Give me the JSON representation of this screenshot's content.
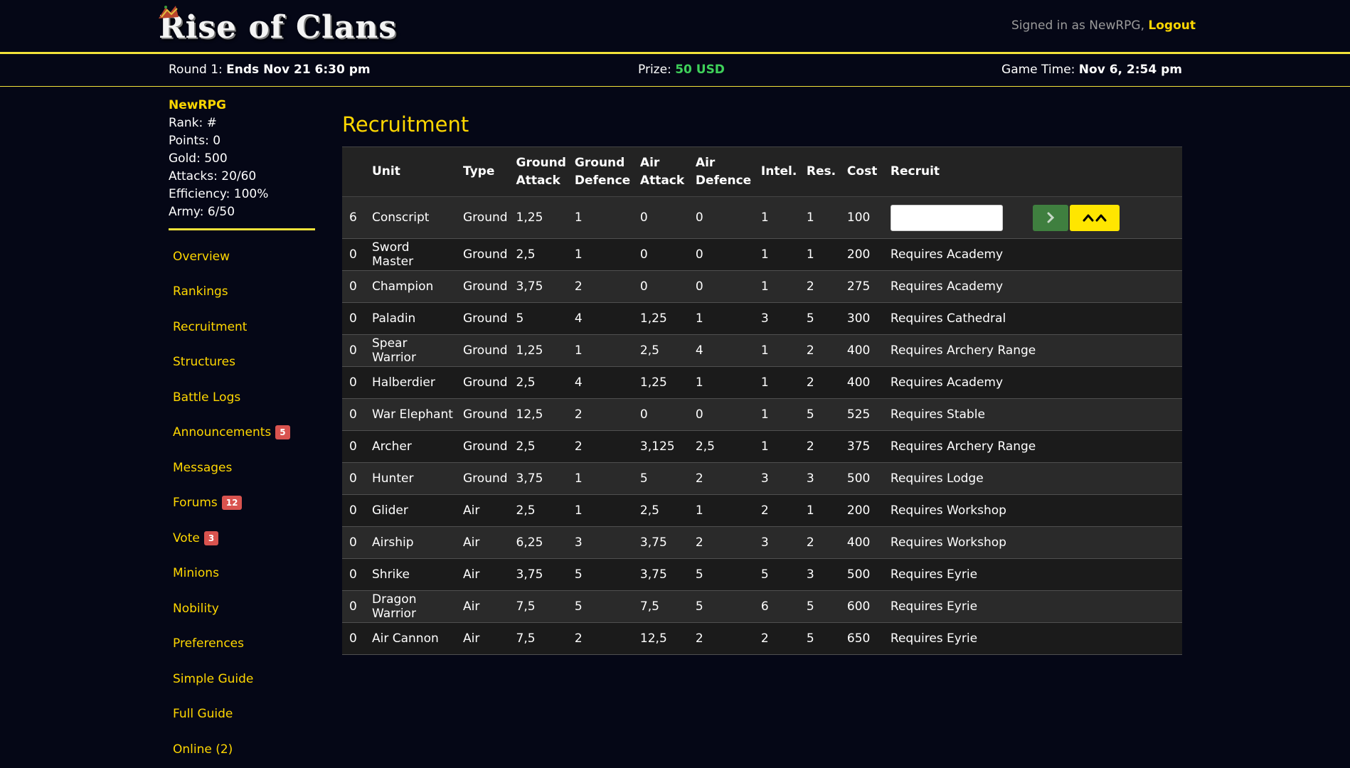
{
  "header": {
    "logo_text": "Rise of Clans",
    "signed_in_prefix": "Signed in as NewRPG,",
    "logout_label": "Logout"
  },
  "infobar": {
    "round_label": "Round 1:",
    "round_value": "Ends Nov 21 6:30 pm",
    "prize_label": "Prize:",
    "prize_value": "50 USD",
    "time_label": "Game Time:",
    "time_value": "Nov 6, 2:54 pm"
  },
  "sidebar": {
    "username": "NewRPG",
    "stats": [
      "Rank: #",
      "Points: 0",
      "Gold: 500",
      "Attacks: 20/60",
      "Efficiency: 100%",
      "Army: 6/50"
    ],
    "nav": [
      {
        "label": "Overview",
        "badge": null
      },
      {
        "label": "Rankings",
        "badge": null
      },
      {
        "label": "Recruitment",
        "badge": null
      },
      {
        "label": "Structures",
        "badge": null
      },
      {
        "label": "Battle Logs",
        "badge": null
      },
      {
        "label": "Announcements",
        "badge": "5"
      },
      {
        "label": "Messages",
        "badge": null
      },
      {
        "label": "Forums",
        "badge": "12"
      },
      {
        "label": "Vote",
        "badge": "3"
      },
      {
        "label": "Minions",
        "badge": null
      },
      {
        "label": "Nobility",
        "badge": null
      },
      {
        "label": "Preferences",
        "badge": null
      },
      {
        "label": "Simple Guide",
        "badge": null
      },
      {
        "label": "Full Guide",
        "badge": null
      },
      {
        "label": "Online (2)",
        "badge": null
      }
    ]
  },
  "main": {
    "title": "Recruitment",
    "headers": {
      "unit": "Unit",
      "type": "Type",
      "ground_attack": [
        "Ground",
        "Attack"
      ],
      "ground_defence": [
        "Ground",
        "Defence"
      ],
      "air_attack": [
        "Air",
        "Attack"
      ],
      "air_defence": [
        "Air",
        "Defence"
      ],
      "intel": "Intel.",
      "res": "Res.",
      "cost": "Cost",
      "recruit": "Recruit"
    },
    "rows": [
      {
        "count": "6",
        "unit": "Conscript",
        "type": "Ground",
        "ga": "1,25",
        "gd": "1",
        "aa": "0",
        "ad": "0",
        "intel": "1",
        "res": "1",
        "cost": "100",
        "recruit": ""
      },
      {
        "count": "0",
        "unit": "Sword Master",
        "type": "Ground",
        "ga": "2,5",
        "gd": "1",
        "aa": "0",
        "ad": "0",
        "intel": "1",
        "res": "1",
        "cost": "200",
        "recruit": "Requires Academy"
      },
      {
        "count": "0",
        "unit": "Champion",
        "type": "Ground",
        "ga": "3,75",
        "gd": "2",
        "aa": "0",
        "ad": "0",
        "intel": "1",
        "res": "2",
        "cost": "275",
        "recruit": "Requires Academy"
      },
      {
        "count": "0",
        "unit": "Paladin",
        "type": "Ground",
        "ga": "5",
        "gd": "4",
        "aa": "1,25",
        "ad": "1",
        "intel": "3",
        "res": "5",
        "cost": "300",
        "recruit": "Requires Cathedral"
      },
      {
        "count": "0",
        "unit": "Spear Warrior",
        "type": "Ground",
        "ga": "1,25",
        "gd": "1",
        "aa": "2,5",
        "ad": "4",
        "intel": "1",
        "res": "2",
        "cost": "400",
        "recruit": "Requires Archery Range"
      },
      {
        "count": "0",
        "unit": "Halberdier",
        "type": "Ground",
        "ga": "2,5",
        "gd": "4",
        "aa": "1,25",
        "ad": "1",
        "intel": "1",
        "res": "2",
        "cost": "400",
        "recruit": "Requires Academy"
      },
      {
        "count": "0",
        "unit": "War Elephant",
        "type": "Ground",
        "ga": "12,5",
        "gd": "2",
        "aa": "0",
        "ad": "0",
        "intel": "1",
        "res": "5",
        "cost": "525",
        "recruit": "Requires Stable"
      },
      {
        "count": "0",
        "unit": "Archer",
        "type": "Ground",
        "ga": "2,5",
        "gd": "2",
        "aa": "3,125",
        "ad": "2,5",
        "intel": "1",
        "res": "2",
        "cost": "375",
        "recruit": "Requires Archery Range"
      },
      {
        "count": "0",
        "unit": "Hunter",
        "type": "Ground",
        "ga": "3,75",
        "gd": "1",
        "aa": "5",
        "ad": "2",
        "intel": "3",
        "res": "3",
        "cost": "500",
        "recruit": "Requires Lodge"
      },
      {
        "count": "0",
        "unit": "Glider",
        "type": "Air",
        "ga": "2,5",
        "gd": "1",
        "aa": "2,5",
        "ad": "1",
        "intel": "2",
        "res": "1",
        "cost": "200",
        "recruit": "Requires Workshop"
      },
      {
        "count": "0",
        "unit": "Airship",
        "type": "Air",
        "ga": "6,25",
        "gd": "3",
        "aa": "3,75",
        "ad": "2",
        "intel": "3",
        "res": "2",
        "cost": "400",
        "recruit": "Requires Workshop"
      },
      {
        "count": "0",
        "unit": "Shrike",
        "type": "Air",
        "ga": "3,75",
        "gd": "5",
        "aa": "3,75",
        "ad": "5",
        "intel": "5",
        "res": "3",
        "cost": "500",
        "recruit": "Requires Eyrie"
      },
      {
        "count": "0",
        "unit": "Dragon Warrior",
        "type": "Air",
        "ga": "7,5",
        "gd": "5",
        "aa": "7,5",
        "ad": "5",
        "intel": "6",
        "res": "5",
        "cost": "600",
        "recruit": "Requires Eyrie"
      },
      {
        "count": "0",
        "unit": "Air Cannon",
        "type": "Air",
        "ga": "7,5",
        "gd": "2",
        "aa": "12,5",
        "ad": "2",
        "intel": "2",
        "res": "5",
        "cost": "650",
        "recruit": "Requires Eyrie"
      }
    ],
    "recruit_input_value": ""
  },
  "colors": {
    "accent": "#ffd700",
    "background": "#050716",
    "prize": "#3fd15a",
    "badge": "#d9534f"
  }
}
